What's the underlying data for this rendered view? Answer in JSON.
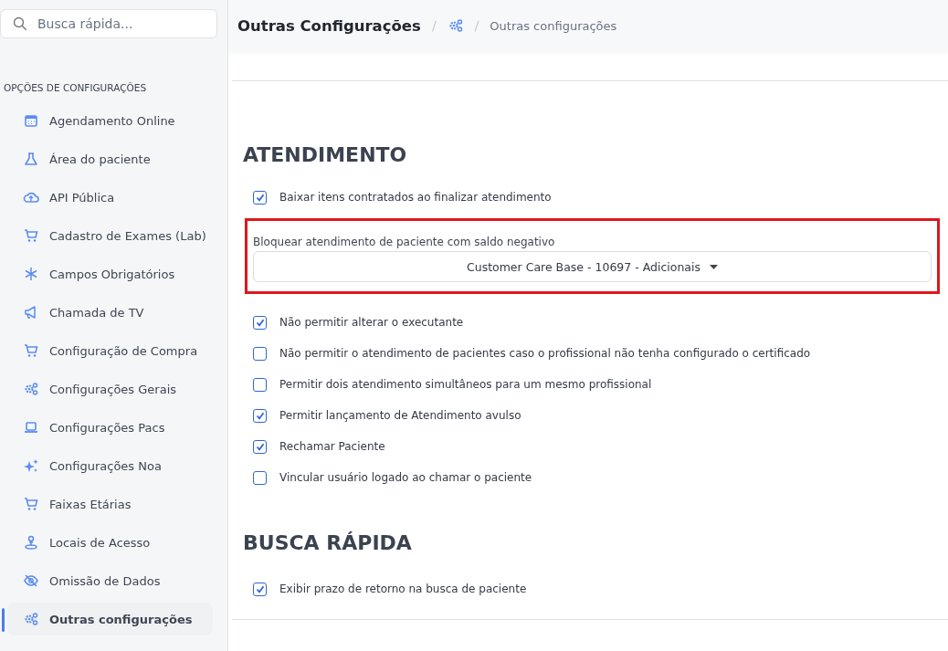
{
  "sidebar": {
    "search": {
      "placeholder": "Busca rápida..."
    },
    "heading": "OPÇÕES DE CONFIGURAÇÕES",
    "items": [
      {
        "label": "Agendamento Online",
        "selected": false
      },
      {
        "label": "Área do paciente",
        "selected": false
      },
      {
        "label": "API Pública",
        "selected": false
      },
      {
        "label": "Cadastro de Exames (Lab)",
        "selected": false
      },
      {
        "label": "Campos Obrigatórios",
        "selected": false
      },
      {
        "label": "Chamada de TV",
        "selected": false
      },
      {
        "label": "Configuração de Compra",
        "selected": false
      },
      {
        "label": "Configurações Gerais",
        "selected": false
      },
      {
        "label": "Configurações Pacs",
        "selected": false
      },
      {
        "label": "Configurações Noa",
        "selected": false
      },
      {
        "label": "Faixas Etárias",
        "selected": false
      },
      {
        "label": "Locais de Acesso",
        "selected": false
      },
      {
        "label": "Omissão de Dados",
        "selected": false
      },
      {
        "label": "Outras configurações",
        "selected": true
      }
    ]
  },
  "header": {
    "title": "Outras Configurações",
    "separators": [
      "/",
      "/"
    ],
    "breadcrumb": "Outras configurações"
  },
  "sections": [
    {
      "title": "ATENDIMENTO",
      "items": [
        {
          "kind": "checkbox",
          "label": "Baixar itens contratados ao finalizar atendimento",
          "checked": true
        },
        {
          "kind": "select",
          "label": "Bloquear atendimento de paciente com saldo negativo",
          "value": "Customer Care Base - 10697 - Adicionais",
          "highlighted": true
        },
        {
          "kind": "checkbox",
          "label": "Não permitir alterar o executante",
          "checked": true
        },
        {
          "kind": "checkbox",
          "label": "Não permitir o atendimento de pacientes caso o profissional não tenha configurado o certificado",
          "checked": false
        },
        {
          "kind": "checkbox",
          "label": "Permitir dois atendimento simultâneos para um mesmo profissional",
          "checked": false
        },
        {
          "kind": "checkbox",
          "label": "Permitir lançamento de Atendimento avulso",
          "checked": true
        },
        {
          "kind": "checkbox",
          "label": "Rechamar Paciente",
          "checked": true
        },
        {
          "kind": "checkbox",
          "label": "Vincular usuário logado ao chamar o paciente",
          "checked": false
        }
      ]
    },
    {
      "title": "BUSCA RÁPIDA",
      "items": [
        {
          "kind": "checkbox",
          "label": "Exibir prazo de retorno na busca de paciente",
          "checked": true
        }
      ]
    }
  ]
}
